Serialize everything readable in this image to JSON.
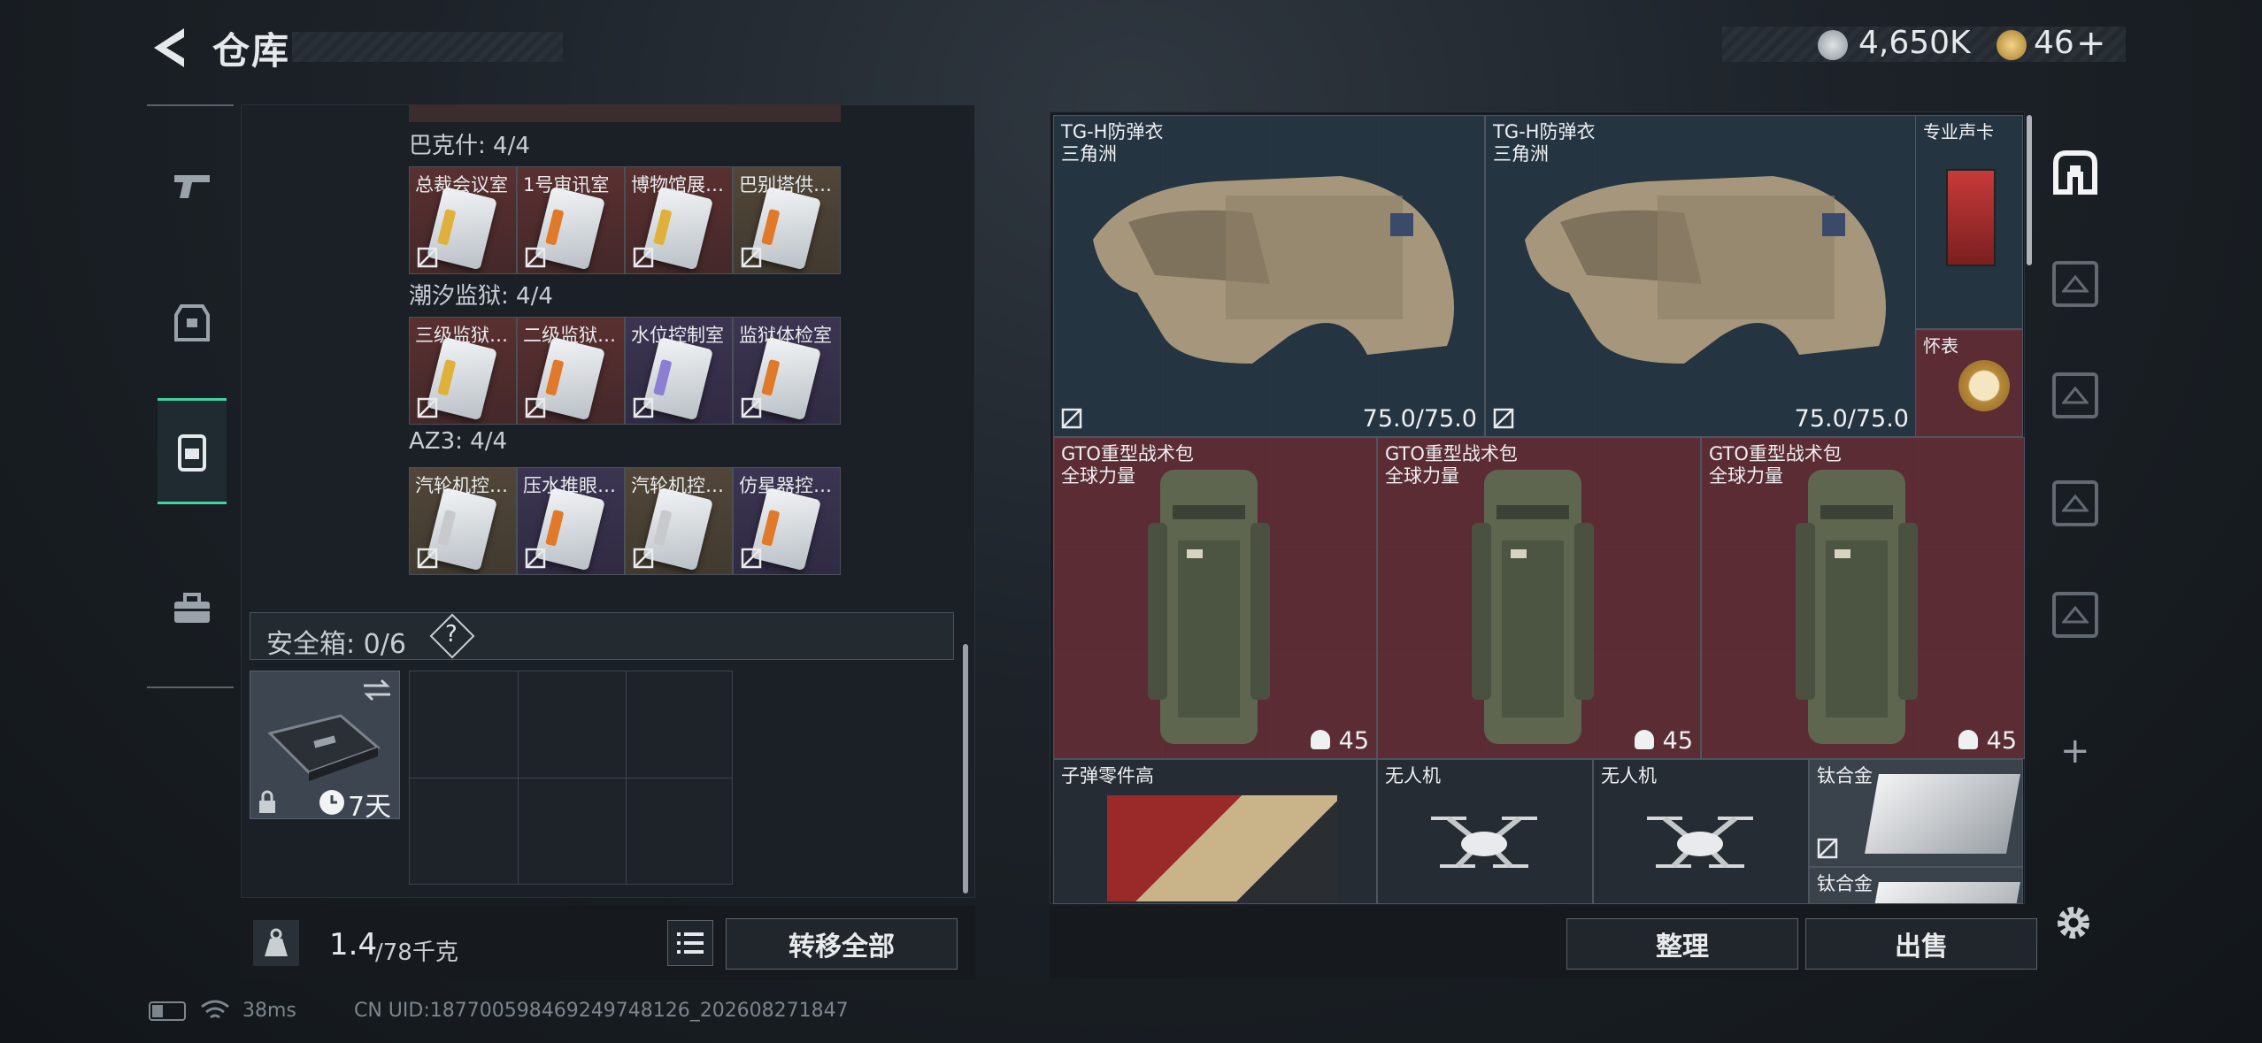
{
  "header": {
    "title": "仓库",
    "currency_amount": "4,650K",
    "premium_amount": "46",
    "premium_plus": "+"
  },
  "colors": {
    "accent": "#3fd3a0",
    "red_cell": "#5b2c34",
    "blue_cell": "#243441"
  },
  "left_nav": {
    "items": [
      "pistol-icon",
      "armor-icon",
      "backpack-icon",
      "briefcase-icon"
    ],
    "active": 2
  },
  "keycards": {
    "sections": [
      {
        "title": "巴克什: 4/4",
        "cards": [
          {
            "label": "总裁会议室",
            "tone": "red"
          },
          {
            "label": "1号审讯室",
            "tone": "red"
          },
          {
            "label": "博物馆展…",
            "tone": "red"
          },
          {
            "label": "巴别塔供…",
            "tone": "brown"
          }
        ]
      },
      {
        "title": "潮汐监狱: 4/4",
        "cards": [
          {
            "label": "三级监狱…",
            "tone": "red"
          },
          {
            "label": "二级监狱…",
            "tone": "red"
          },
          {
            "label": "水位控制室",
            "tone": "purple"
          },
          {
            "label": "监狱体检室",
            "tone": "purple"
          }
        ]
      },
      {
        "title": "AZ3: 4/4",
        "cards": [
          {
            "label": "汽轮机控…",
            "tone": "brown"
          },
          {
            "label": "压水推眼…",
            "tone": "purple"
          },
          {
            "label": "汽轮机控…",
            "tone": "brown"
          },
          {
            "label": "仿星器控…",
            "tone": "purple"
          }
        ]
      }
    ]
  },
  "safe_box": {
    "label": "安全箱: 0/6",
    "help": "?",
    "timer": "7天"
  },
  "weight": {
    "current": "1.4",
    "max": "/78千克"
  },
  "buttons": {
    "transfer_all": "转移全部",
    "organize": "整理",
    "sell": "出售"
  },
  "stash": {
    "vests": [
      {
        "name": "TG-H防弹衣",
        "brand": "三角洲",
        "durability": "75.0/75.0"
      },
      {
        "name": "TG-H防弹衣",
        "brand": "三角洲",
        "durability": "75.0/75.0"
      }
    ],
    "small_items": [
      {
        "name": "专业声卡"
      },
      {
        "name": "怀表"
      }
    ],
    "backpacks": [
      {
        "name": "GTO重型战术包",
        "brand": "全球力量",
        "count": "45"
      },
      {
        "name": "GTO重型战术包",
        "brand": "全球力量",
        "count": "45"
      },
      {
        "name": "GTO重型战术包",
        "brand": "全球力量",
        "count": "45"
      }
    ],
    "bottom_row": [
      {
        "name": "子弹零件高"
      },
      {
        "name": "无人机"
      },
      {
        "name": "无人机"
      },
      {
        "name": "钛合金"
      },
      {
        "name": "钛合金"
      }
    ]
  },
  "status_bar": {
    "ping": "38ms",
    "uid": "CN UID:18770059846924974812​6_202608271847"
  },
  "right_nav": {
    "items": [
      "home-icon",
      "stash-page-1-icon",
      "stash-page-2-icon",
      "stash-page-3-icon",
      "stash-page-4-icon"
    ],
    "add": "+"
  }
}
